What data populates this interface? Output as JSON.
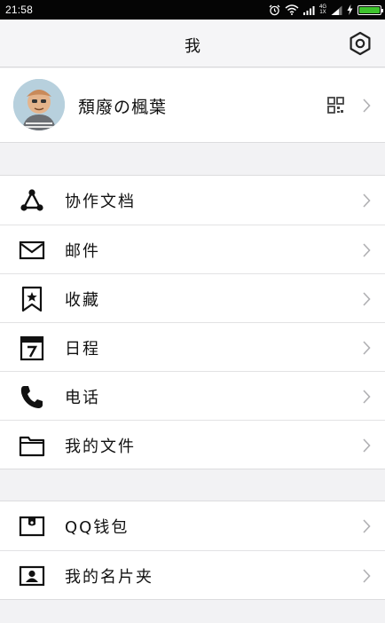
{
  "status_bar": {
    "time": "21:58",
    "network": "4G",
    "network_sub": "1X",
    "battery_level": 1.0,
    "battery_color": "#3ec42d"
  },
  "header": {
    "title": "我"
  },
  "profile": {
    "nickname": "頽廢の楓葉"
  },
  "groups": [
    {
      "items": [
        {
          "label": "协作文档",
          "icon": "collaboration-icon"
        },
        {
          "label": "邮件",
          "icon": "mail-icon"
        },
        {
          "label": "收藏",
          "icon": "bookmark-star-icon"
        },
        {
          "label": "日程",
          "icon": "calendar-icon"
        },
        {
          "label": "电话",
          "icon": "phone-icon"
        },
        {
          "label": "我的文件",
          "icon": "folder-icon"
        }
      ]
    },
    {
      "items": [
        {
          "label": "QQ钱包",
          "icon": "wallet-icon"
        },
        {
          "label": "我的名片夹",
          "icon": "business-card-icon"
        }
      ]
    }
  ]
}
